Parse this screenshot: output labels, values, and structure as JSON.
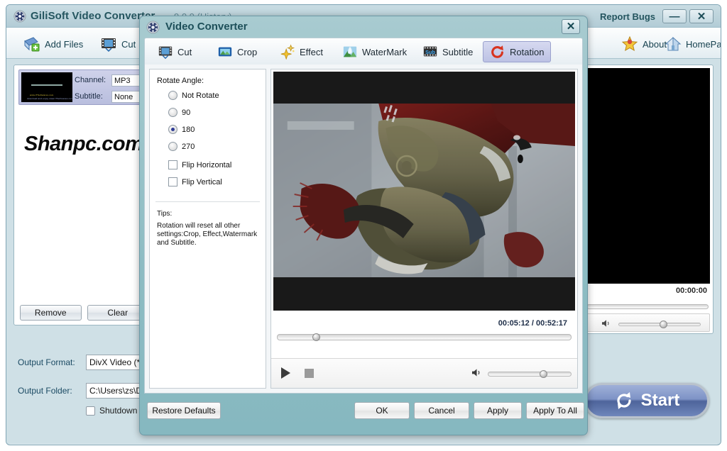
{
  "main_window": {
    "title": "GiliSoft Video Converter",
    "version": "9.0.0 (History)",
    "icon": "app-gear-icon",
    "report_bugs": "Report Bugs",
    "minimize": "—",
    "close": "✕",
    "toolbar": [
      {
        "label": "Add Files",
        "icon": "add-files-icon"
      },
      {
        "label": "Cut",
        "icon": "cut-film-icon"
      },
      {
        "label": "About",
        "icon": "about-star-icon"
      },
      {
        "label": "HomePage",
        "icon": "home-icon"
      }
    ],
    "file_list": {
      "channel_label": "Channel:",
      "channel_value": "MP3",
      "subtitle_label": "Subtitle:",
      "subtitle_value": "None",
      "thumb_text_1": "www.ITSoftwares.com",
      "thumb_text_2": "download and enjoy www.ITSoftwares.com",
      "remove_label": "Remove",
      "clear_label": "Clear"
    },
    "watermark": "Shanpc.com",
    "output_format_label": "Output Format:",
    "output_format_value": "DivX Video (*",
    "output_folder_label": "Output Folder:",
    "output_folder_value": "C:\\Users\\zs\\D",
    "shutdown_label": "Shutdown a",
    "preview": {
      "time": "00:00:00",
      "volume_icon": "speaker-icon"
    },
    "start_label": "Start",
    "start_icon": "refresh-circle-icon"
  },
  "dialog": {
    "title": "Video Converter",
    "icon": "app-gear-icon",
    "close": "✕",
    "tabs": [
      {
        "label": "Cut",
        "icon": "cut-film-icon",
        "active": false
      },
      {
        "label": "Crop",
        "icon": "crop-picture-icon",
        "active": false
      },
      {
        "label": "Effect",
        "icon": "effect-stars-icon",
        "active": false
      },
      {
        "label": "WaterMark",
        "icon": "watermark-drop-icon",
        "active": false
      },
      {
        "label": "Subtitle",
        "icon": "subtitle-sub-icon",
        "active": false
      },
      {
        "label": "Rotation",
        "icon": "rotation-arrow-icon",
        "active": true
      }
    ],
    "rotation": {
      "group_label": "Rotate Angle:",
      "options": [
        {
          "label": "Not Rotate",
          "selected": false
        },
        {
          "label": "90",
          "selected": false
        },
        {
          "label": "180",
          "selected": true
        },
        {
          "label": "270",
          "selected": false
        }
      ],
      "checkboxes": [
        {
          "label": "Flip Horizontal",
          "checked": false
        },
        {
          "label": "Flip Vertical",
          "checked": false
        }
      ],
      "tips_title": "Tips:",
      "tips_body": "Rotation will reset all other settings:Crop, Effect,Watermark and Subtitle."
    },
    "player": {
      "current_time": "00:05:12",
      "total_time": "00:52:17",
      "time_display": "00:05:12 / 00:52:17",
      "seek_percent": 12,
      "volume_percent": 62,
      "play_icon": "play-icon",
      "stop_icon": "stop-icon",
      "volume_icon": "speaker-icon"
    },
    "footer": {
      "restore_defaults": "Restore Defaults",
      "ok": "OK",
      "cancel": "Cancel",
      "apply": "Apply",
      "apply_to_all": "Apply To All"
    }
  },
  "colors": {
    "dialog_bg": "#8dbcc3",
    "title_text": "#1d4f59",
    "accent_tab": "#bcc2e4",
    "radio_dot": "#2f3c95",
    "start_button": "#4e649b"
  }
}
